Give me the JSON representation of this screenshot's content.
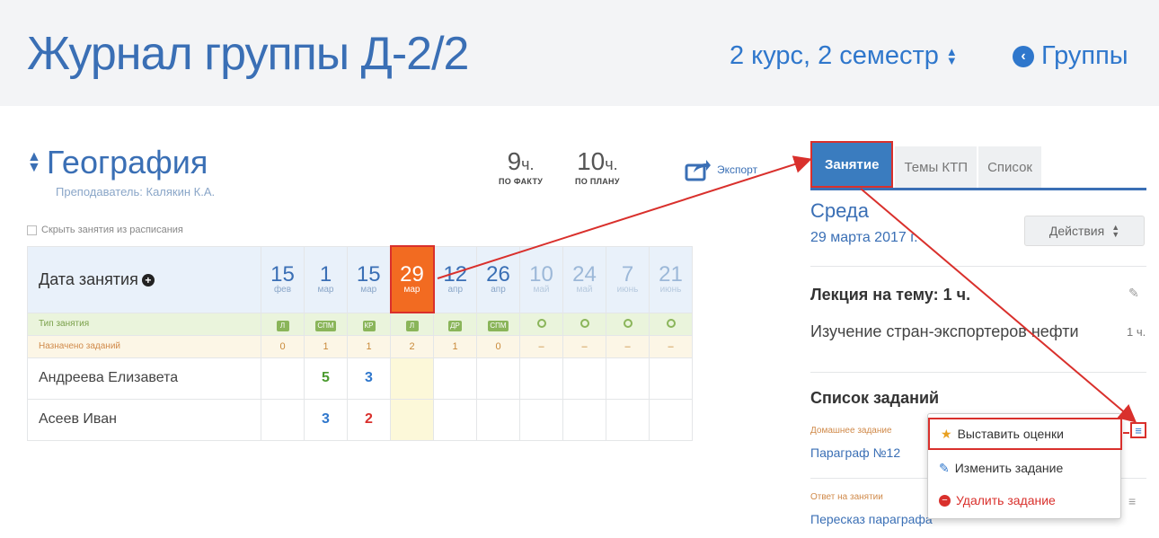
{
  "header": {
    "title": "Журнал группы Д-2/2",
    "semester": "2 курс, 2 семестр",
    "groups_link": "Группы"
  },
  "subject": {
    "name": "География",
    "teacher": "Преподаватель: Калякин К.А.",
    "hide_label": "Скрыть занятия из расписания",
    "hours_fact": "9",
    "hours_fact_unit": "ч.",
    "hours_fact_label": "ПО ФАКТУ",
    "hours_plan": "10",
    "hours_plan_unit": "ч.",
    "hours_plan_label": "ПО ПЛАНУ",
    "export_label": "Экспорт"
  },
  "journal": {
    "date_header": "Дата занятия",
    "type_label": "Тип занятия",
    "assign_label": "Назначено заданий",
    "dates": [
      {
        "d": "15",
        "m": "фев"
      },
      {
        "d": "1",
        "m": "мар"
      },
      {
        "d": "15",
        "m": "мар"
      },
      {
        "d": "29",
        "m": "мар"
      },
      {
        "d": "12",
        "m": "апр"
      },
      {
        "d": "26",
        "m": "апр"
      },
      {
        "d": "10",
        "m": "май"
      },
      {
        "d": "24",
        "m": "май"
      },
      {
        "d": "7",
        "m": "июнь"
      },
      {
        "d": "21",
        "m": "июнь"
      }
    ],
    "types": [
      "Л",
      "СПМ",
      "КР",
      "Л",
      "ДР",
      "СПМ",
      "",
      "",
      "",
      ""
    ],
    "assigned": [
      "0",
      "1",
      "1",
      "2",
      "1",
      "0",
      "–",
      "–",
      "–",
      "–"
    ],
    "students": [
      {
        "name": "Андреева Елизавета",
        "grades": [
          "",
          "5",
          "3",
          "",
          "",
          "",
          "",
          "",
          "",
          ""
        ]
      },
      {
        "name": "Асеев Иван",
        "grades": [
          "",
          "3",
          "2",
          "",
          "",
          "",
          "",
          "",
          "",
          ""
        ]
      }
    ]
  },
  "panel": {
    "tabs": [
      "Занятие",
      "Темы КТП",
      "Список"
    ],
    "day": "Среда",
    "date": "29 марта 2017 г.",
    "actions": "Действия",
    "lecture": "Лекция на тему: 1 ч.",
    "topic": "Изучение стран-экспортеров нефти",
    "topic_hours": "1 ч.",
    "tasks_heading": "Список заданий",
    "task1_type": "Домашнее задание",
    "task1_name": "Параграф №12",
    "task2_type": "Ответ на занятии",
    "task2_name": "Пересказ параграфа"
  },
  "dropdown": {
    "set_grades": "Выставить оценки",
    "edit_task": "Изменить задание",
    "delete_task": "Удалить задание"
  },
  "colors": {
    "accent": "#3a6fb5",
    "active_date": "#f26b21",
    "annotation": "#d9302c"
  }
}
